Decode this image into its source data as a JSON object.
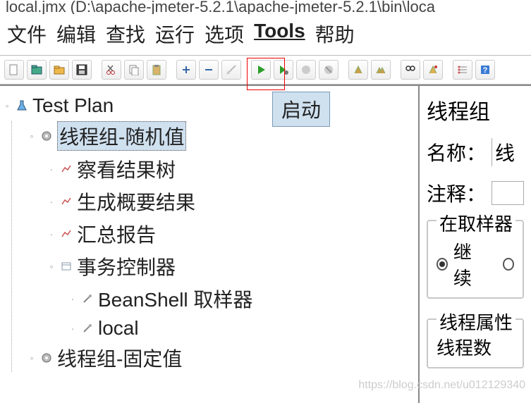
{
  "title_bar": "local.jmx (D:\\apache-jmeter-5.2.1\\apache-jmeter-5.2.1\\bin\\loca",
  "menu": {
    "file": "文件",
    "edit": "编辑",
    "search": "查找",
    "run": "运行",
    "options": "选项",
    "tools": "Tools",
    "help": "帮助"
  },
  "toolbar": {
    "start_tooltip": "启动"
  },
  "tree": {
    "root": "Test Plan",
    "group_random": "线程组-随机值",
    "view_results": "察看结果树",
    "summary_report": "生成概要结果",
    "aggregate_report": "汇总报告",
    "transaction_ctrl": "事务控制器",
    "beanshell": "BeanShell 取样器",
    "local_sampler": "local",
    "group_fixed": "线程组-固定值"
  },
  "right": {
    "heading": "线程组",
    "name_label": "名称：",
    "name_value": "线",
    "comment_label": "注释：",
    "sampler_error_group": "在取样器",
    "continue_option": "继续",
    "thread_props_group": "线程属性",
    "thread_count_label": "线程数"
  },
  "watermark": "https://blog.csdn.net/u012129340"
}
